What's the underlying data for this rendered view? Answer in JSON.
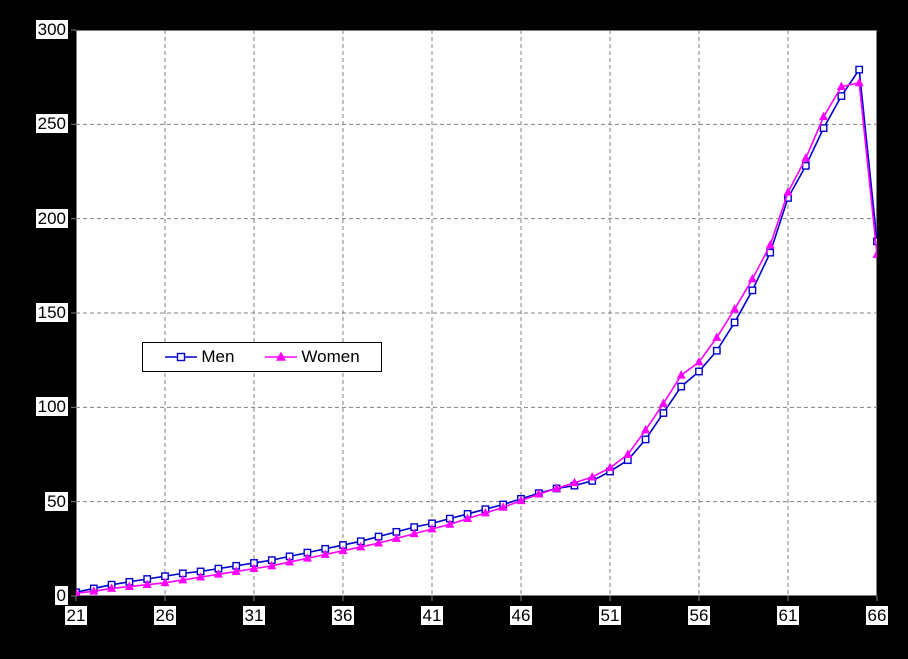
{
  "chart_data": {
    "type": "line",
    "title": "",
    "subtitle": "",
    "xlabel": "",
    "ylabel": "",
    "xlim": [
      21,
      66
    ],
    "ylim": [
      0,
      300
    ],
    "grid": true,
    "legend_position": "center-left",
    "background_color": "#000000",
    "plot_background_color": "#ffffff",
    "grid_color": "#808080",
    "axis_color": "#808080",
    "x_ticks": [
      21,
      26,
      31,
      36,
      41,
      46,
      51,
      56,
      61,
      66
    ],
    "y_ticks": [
      0,
      50,
      100,
      150,
      200,
      250,
      300
    ],
    "x": [
      21,
      22,
      23,
      24,
      25,
      26,
      27,
      28,
      29,
      30,
      31,
      32,
      33,
      34,
      35,
      36,
      37,
      38,
      39,
      40,
      41,
      42,
      43,
      44,
      45,
      46,
      47,
      48,
      49,
      50,
      51,
      52,
      53,
      54,
      55,
      56,
      57,
      58,
      59,
      60,
      61,
      62,
      63,
      64,
      65,
      66
    ],
    "series": [
      {
        "name": "Men",
        "color": "#0000CC",
        "marker": "square",
        "values": [
          2,
          4,
          6,
          7.5,
          9,
          10.5,
          12,
          13,
          14.5,
          16,
          17.5,
          19,
          21,
          23,
          25,
          27,
          29,
          31.5,
          34,
          36.5,
          38.5,
          41,
          43.5,
          46,
          48.5,
          51.5,
          54.5,
          57,
          58.5,
          61,
          66,
          72,
          83,
          97,
          111,
          119,
          130,
          145,
          162,
          182,
          211,
          228,
          248,
          265,
          279,
          188
        ]
      },
      {
        "name": "Women",
        "color": "#FF00FF",
        "marker": "triangle",
        "values": [
          1.5,
          2.5,
          4,
          5,
          6,
          7,
          8.5,
          10,
          11.5,
          13,
          14.5,
          16,
          18,
          20,
          22,
          24,
          26,
          28,
          30.5,
          33,
          35.5,
          38,
          41,
          44,
          47,
          50.5,
          54,
          57,
          60,
          63,
          68,
          75,
          88,
          102,
          117,
          124,
          137,
          152,
          168,
          186,
          214,
          232,
          254,
          270,
          272,
          181
        ]
      }
    ]
  },
  "legend": {
    "entries": [
      {
        "label": "Men"
      },
      {
        "label": "Women"
      }
    ]
  },
  "axes": {
    "y_tick_labels": [
      "300",
      "250",
      "200",
      "150",
      "100",
      "50",
      "0"
    ],
    "x_tick_labels": [
      "21",
      "26",
      "31",
      "36",
      "41",
      "46",
      "51",
      "56",
      "61",
      "66"
    ]
  }
}
